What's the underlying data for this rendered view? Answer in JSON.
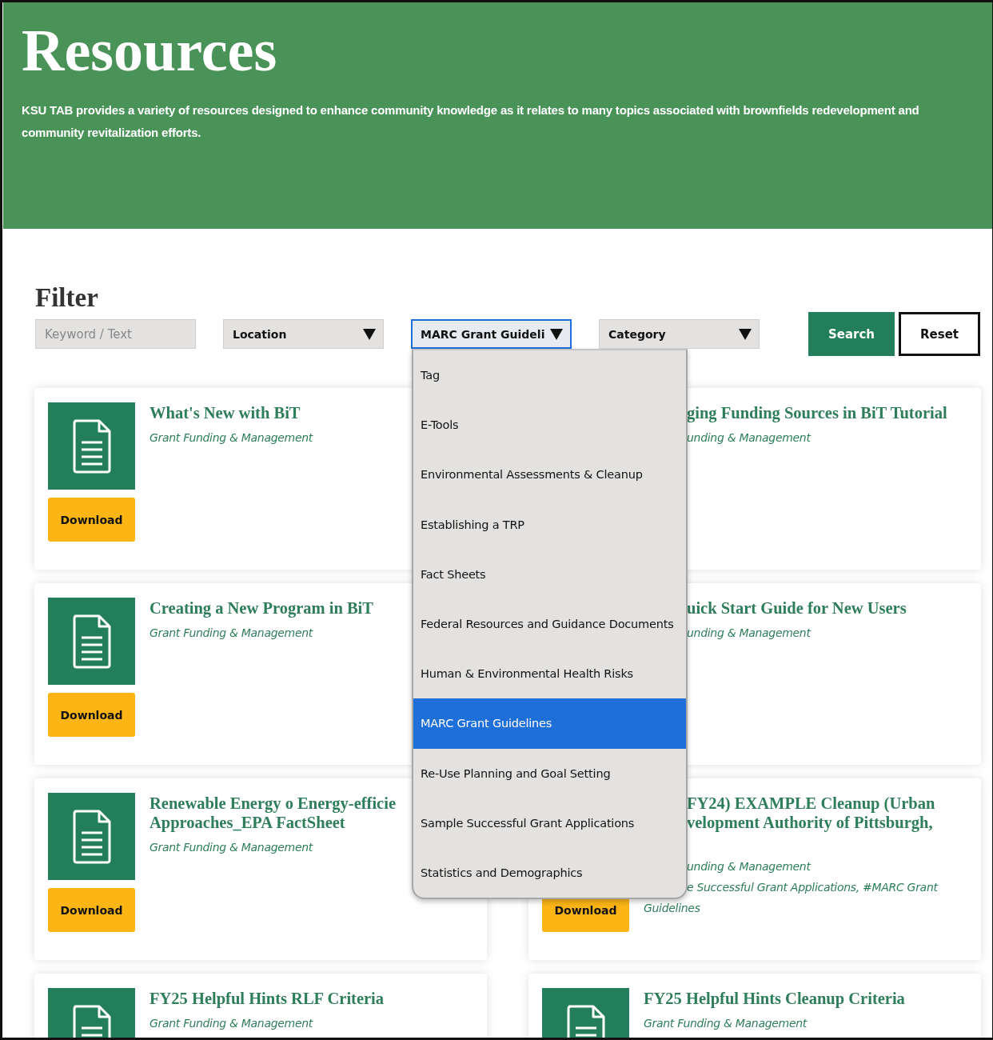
{
  "header": {
    "title": "Resources",
    "description": "KSU TAB provides a variety of resources designed to enhance community knowledge as it relates to many topics associated with brownfields redevelopment and community revitalization efforts."
  },
  "filter": {
    "title": "Filter",
    "keyword": {
      "placeholder": "Keyword / Text"
    },
    "selects": [
      {
        "value": "Location",
        "focused": false
      },
      {
        "value": "MARC Grant Guideli",
        "focused": true,
        "options": [
          {
            "label": "Tag",
            "selected": false
          },
          {
            "label": "E-Tools",
            "selected": false
          },
          {
            "label": "Environmental Assessments & Cleanup",
            "selected": false
          },
          {
            "label": "Establishing a TRP",
            "selected": false
          },
          {
            "label": "Fact Sheets",
            "selected": false
          },
          {
            "label": "Federal Resources and Guidance Documents",
            "selected": false
          },
          {
            "label": "Human & Environmental Health Risks",
            "selected": false
          },
          {
            "label": "MARC Grant Guidelines",
            "selected": true
          },
          {
            "label": "Re-Use Planning and Goal Setting",
            "selected": false
          },
          {
            "label": "Sample Successful Grant Applications",
            "selected": false
          },
          {
            "label": "Statistics and Demographics",
            "selected": false
          }
        ]
      },
      {
        "value": "Category",
        "focused": false
      }
    ],
    "buttons": [
      {
        "label": "Search",
        "kind": "primary"
      },
      {
        "label": "Reset",
        "kind": "outline"
      }
    ]
  },
  "cards": [
    {
      "icon": true,
      "download": "Download",
      "title_lines": [
        "What's New with BiT"
      ],
      "category": "Grant Funding & Management"
    },
    {
      "icon": false,
      "title_lines": [
        "ging Funding Sources in BiT Tutorial"
      ],
      "category": "unding & Management"
    },
    {
      "icon": true,
      "download": "Download",
      "title_lines": [
        "Creating a New Program in BiT"
      ],
      "category": "Grant Funding & Management"
    },
    {
      "icon": false,
      "title_lines": [
        "uick Start Guide for New Users"
      ],
      "category": "unding & Management"
    },
    {
      "icon": true,
      "download": "Download",
      "title_lines": [
        "Renewable Energy o Energy-efficie",
        "Approaches_EPA FactSheet"
      ],
      "category": "Grant Funding & Management"
    },
    {
      "icon": false,
      "download": "Download",
      "title_lines": [
        "FY24) EXAMPLE Cleanup (Urban",
        "velopment Authority of Pittsburgh,"
      ],
      "category": "unding & Management",
      "tags": "e Successful Grant Applications, #MARC Grant Guidelines"
    },
    {
      "icon": true,
      "title_lines": [
        "FY25 Helpful Hints RLF Criteria"
      ],
      "category": "Grant Funding & Management"
    },
    {
      "icon": true,
      "title_lines": [
        "FY25 Helpful Hints Cleanup Criteria"
      ],
      "category": "Grant Funding & Management"
    }
  ]
}
